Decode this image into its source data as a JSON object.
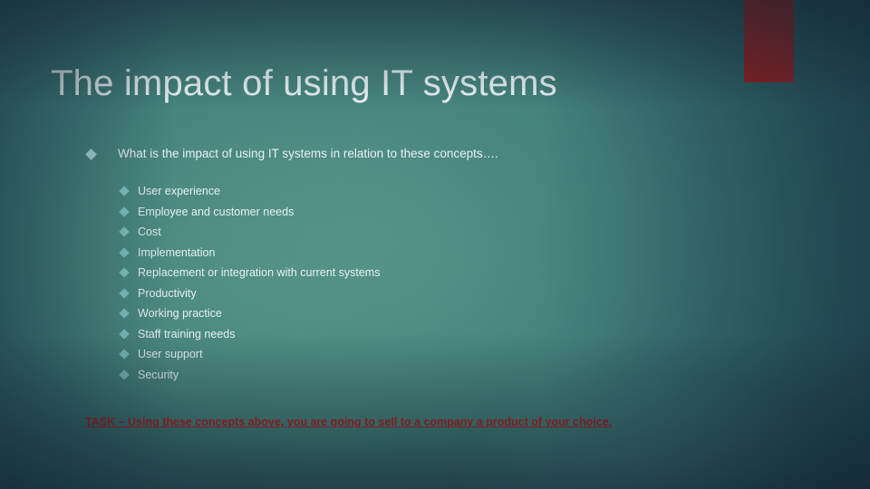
{
  "slide": {
    "title": "The impact of using IT systems",
    "accent_color": "#b81818",
    "title_color": "#eaf3f4",
    "body_text_color": "#e8f2f2",
    "task_color": "#c31616",
    "background_colors": [
      "#1d4252",
      "#43837b",
      "#55918a",
      "#183a4b"
    ]
  },
  "content": {
    "lead_bullet": {
      "icon": "diamond-bullet-icon",
      "text": "What is the impact of using IT systems in relation to these concepts…."
    },
    "concepts": [
      {
        "icon": "diamond-bullet-icon",
        "label": "User experience"
      },
      {
        "icon": "diamond-bullet-icon",
        "label": "Employee and customer needs"
      },
      {
        "icon": "diamond-bullet-icon",
        "label": "Cost"
      },
      {
        "icon": "diamond-bullet-icon",
        "label": "Implementation"
      },
      {
        "icon": "diamond-bullet-icon",
        "label": "Replacement or integration with current systems"
      },
      {
        "icon": "diamond-bullet-icon",
        "label": "Productivity"
      },
      {
        "icon": "diamond-bullet-icon",
        "label": "Working practice"
      },
      {
        "icon": "diamond-bullet-icon",
        "label": "Staff training needs"
      },
      {
        "icon": "diamond-bullet-icon",
        "label": "User support"
      },
      {
        "icon": "diamond-bullet-icon",
        "label": "Security"
      }
    ],
    "task_note": "TASK – Using these concepts above, you are going to sell to a company a product of your choice."
  }
}
